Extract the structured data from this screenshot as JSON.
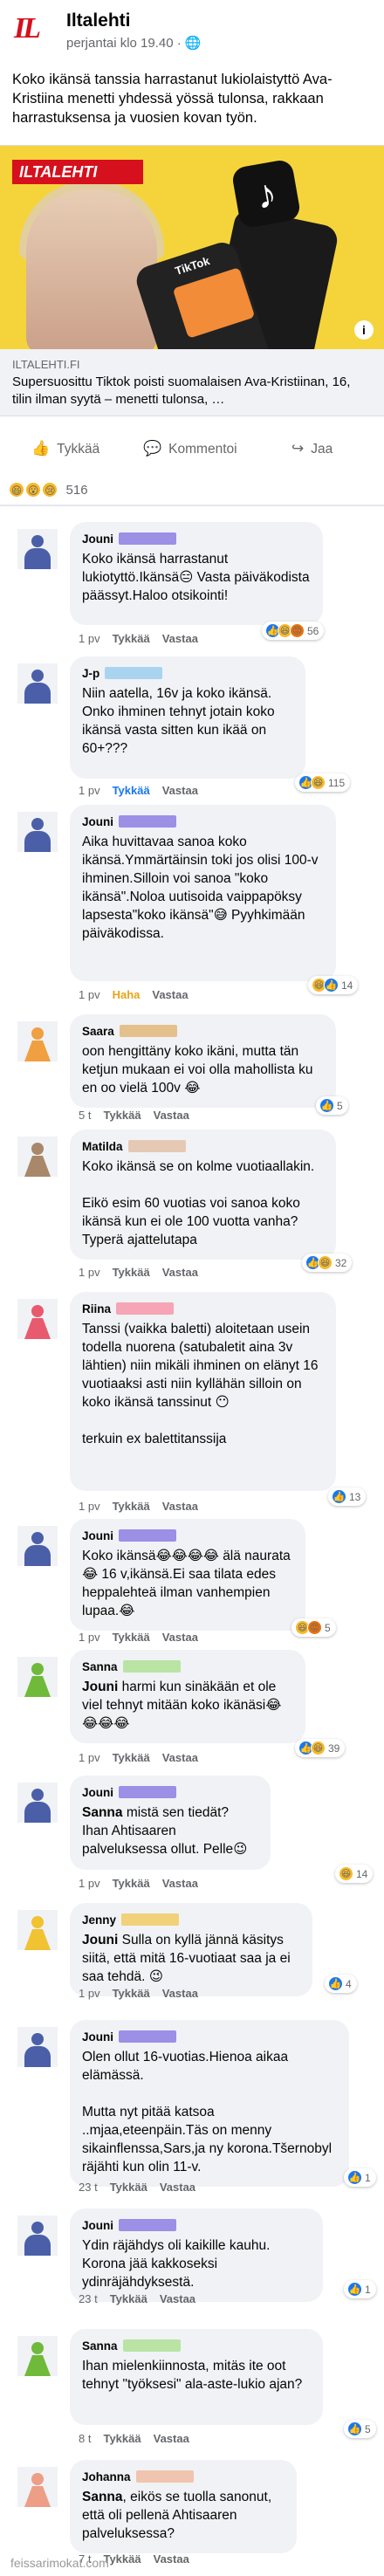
{
  "post": {
    "author": "Iltalehti",
    "time": "perjantai klo 19.40 · ",
    "globe": "🌐",
    "logo": "IL",
    "text": "Koko ikänsä tanssia harrastanut lukiolaistyttö Ava-Kristiina menetti yhdessä yössä tulonsa, rakkaan harrastuksensa ja vuosien kovan työn."
  },
  "link": {
    "badge": "ILTALEHTI",
    "tiktok_text": "TikTok",
    "source": "ILTALEHTI.FI",
    "title": "Supersuosittu Tiktok poisti suomalaisen Ava-Kristiinan, 16, tilin ilman syytä – menetti tulonsa, …",
    "info": "i"
  },
  "actions": {
    "like": "Tykkää",
    "comment": "Kommentoi",
    "share": "Jaa",
    "like_icon": "👍",
    "comment_icon": "💬",
    "share_icon": "↪"
  },
  "reactions": {
    "icons": [
      "😆",
      "😮",
      "😢"
    ],
    "count": "516"
  },
  "comments": [
    {
      "author": "Jouni",
      "gender": "male",
      "name_color": "#9b8fe6",
      "text": "Koko ikänsä harrastanut lukiotyttö.Ikänsä😑 Vasta päiväkodista päässyt.Haloo otsikointi!",
      "time": "1 pv",
      "like": "Tykkää",
      "reply": "Vastaa",
      "liked": false,
      "reacts": [
        "👍",
        "😆",
        "😡"
      ],
      "react_count": "56"
    },
    {
      "author": "J-p",
      "gender": "male",
      "name_color": "#a9d4f0",
      "text": "Niin aatella, 16v ja koko ikänsä. Onko ihminen tehnyt jotain koko ikänsä vasta sitten kun ikää on 60+???",
      "time": "1 pv",
      "like": "Tykkää",
      "reply": "Vastaa",
      "liked": true,
      "reacts": [
        "👍",
        "😆"
      ],
      "react_count": "115"
    },
    {
      "author": "Jouni",
      "gender": "male",
      "name_color": "#9b8fe6",
      "text": "Aika huvittavaa sanoa koko ikänsä.Ymmärtäinsin toki jos olisi 100-v ihminen.Silloin voi sanoa \"koko ikänsä\".Noloa uutisoida vaippapöksy lapsesta\"koko ikänsä\"😅 Pyyhkimään päiväkodissa.",
      "time": "1 pv",
      "like": "Haha",
      "reply": "Vastaa",
      "liked": "haha",
      "reacts": [
        "😆",
        "👍"
      ],
      "react_count": "14"
    },
    {
      "author": "Saara",
      "gender": "female_orange",
      "name_color": "#e4c08c",
      "text": "oon hengittäny koko ikäni, mutta tän ketjun mukaan ei voi olla mahollista ku en oo vielä 100v 😂",
      "time": "5 t",
      "like": "Tykkää",
      "reply": "Vastaa",
      "liked": false,
      "reacts": [
        "👍"
      ],
      "react_count": "5"
    },
    {
      "author": "Matilda",
      "gender": "female_brown",
      "name_color": "#e6c9b4",
      "text": "Koko ikänsä se on kolme vuotiaallakin.\n\nEikö esim 60 vuotias voi sanoa koko ikänsä kun ei ole 100 vuotta vanha? Typerä ajattelutapa",
      "time": "1 pv",
      "like": "Tykkää",
      "reply": "Vastaa",
      "liked": false,
      "reacts": [
        "👍",
        "😆"
      ],
      "react_count": "32"
    },
    {
      "author": "Riina",
      "gender": "female_pink",
      "name_color": "#f5a5b5",
      "text": "Tanssi (vaikka baletti) aloitetaan usein todella nuorena (satubaletit aina 3v lähtien) niin mikäli ihminen on elänyt 16 vuotiaaksi asti niin kyllähän silloin on koko ikänsä tanssinut 😶\n\nterkuin ex balettitanssija",
      "time": "1 pv",
      "like": "Tykkää",
      "reply": "Vastaa",
      "liked": false,
      "reacts": [
        "👍"
      ],
      "react_count": "13"
    },
    {
      "author": "Jouni",
      "gender": "male",
      "name_color": "#9b8fe6",
      "text": "Koko ikänsä😂😂😂😂 älä naurata😂 16 v,ikänsä.Ei saa tilata edes heppalehteä ilman vanhempien lupaa.😂",
      "time": "1 pv",
      "like": "Tykkää",
      "reply": "Vastaa",
      "liked": false,
      "reacts": [
        "😆",
        "😡"
      ],
      "react_count": "5"
    },
    {
      "author": "Sanna",
      "gender": "female_green",
      "name_color": "#b9e4a4",
      "text": "<b>Jouni</b> harmi kun sinäkään et ole viel tehnyt mitään koko ikänäsi😂😂😂😂",
      "time": "1 pv",
      "like": "Tykkää",
      "reply": "Vastaa",
      "liked": false,
      "reacts": [
        "👍",
        "😆"
      ],
      "react_count": "39"
    },
    {
      "author": "Jouni",
      "gender": "male",
      "name_color": "#9b8fe6",
      "text": "<b>Sanna</b> mistä sen tiedät? Ihan Ahtisaaren palveluksessa ollut. Pelle😉",
      "time": "1 pv",
      "like": "Tykkää",
      "reply": "Vastaa",
      "liked": false,
      "reacts": [
        "😆"
      ],
      "react_count": "14"
    },
    {
      "author": "Jenny",
      "gender": "female_yellow",
      "name_color": "#f1d17a",
      "text": "<b>Jouni</b> Sulla on kyllä jännä käsitys siitä, että mitä 16-vuotiaat saa ja ei saa tehdä. 😉",
      "time": "1 pv",
      "like": "Tykkää",
      "reply": "Vastaa",
      "liked": false,
      "reacts": [
        "👍"
      ],
      "react_count": "4"
    },
    {
      "author": "Jouni",
      "gender": "male",
      "name_color": "#9b8fe6",
      "text": "Olen ollut 16-vuotias.Hienoa aikaa elämässä.\n\nMutta nyt pitää katsoa ..mjaa,eteenpäin.Täs on menny sikainflenssa,Sars,ja ny korona.Tšernobyl räjähti kun olin 11-v.",
      "time": "23 t",
      "like": "Tykkää",
      "reply": "Vastaa",
      "liked": false,
      "reacts": [
        "👍"
      ],
      "react_count": "1"
    },
    {
      "author": "Jouni",
      "gender": "male",
      "name_color": "#9b8fe6",
      "text": "Ydin räjähdys oli kaikille kauhu. Korona jää kakkoseksi ydinräjähdyksestä.",
      "time": "23 t",
      "like": "Tykkää",
      "reply": "Vastaa",
      "liked": false,
      "reacts": [
        "👍"
      ],
      "react_count": "1"
    },
    {
      "author": "Sanna",
      "gender": "female_green",
      "name_color": "#b9e4a4",
      "text": "Ihan mielenkiinnosta, mitäs ite oot tehnyt \"työksesi\" ala-aste-lukio ajan?",
      "time": "8 t",
      "like": "Tykkää",
      "reply": "Vastaa",
      "liked": false,
      "reacts": [
        "👍"
      ],
      "react_count": "5"
    },
    {
      "author": "Johanna",
      "gender": "female_peach",
      "name_color": "#f0c4ae",
      "text": "<b>Sanna</b>, eikös se tuolla sanonut, että oli pellenä Ahtisaaren palveluksessa?",
      "time": "7 t",
      "like": "Tykkää",
      "reply": "Vastaa",
      "liked": false,
      "reacts": [],
      "react_count": ""
    }
  ],
  "watermark": "feissarimokat.com"
}
